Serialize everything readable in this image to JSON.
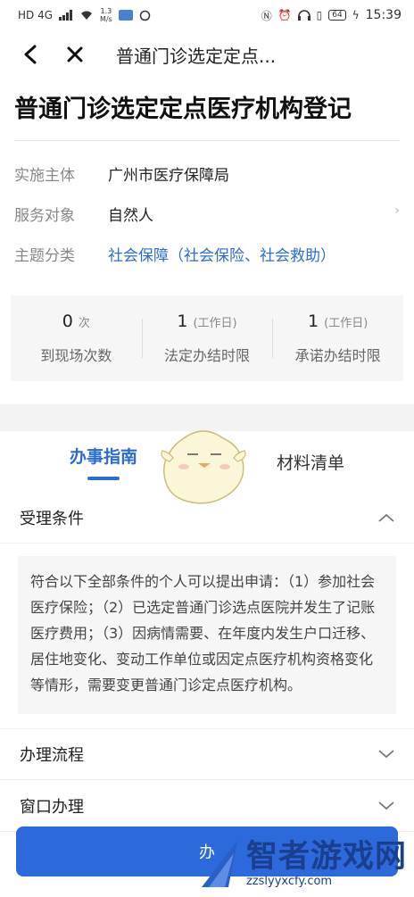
{
  "status_bar": {
    "network": "HD 4G",
    "speed_value": "1.3",
    "speed_unit": "M/s",
    "battery": "64",
    "time": "15:39"
  },
  "nav": {
    "title": "普通门诊选定定点..."
  },
  "page": {
    "title": "普通门诊选定定点医疗机构登记"
  },
  "info": {
    "rows": [
      {
        "label": "实施主体",
        "value": "广州市医疗保障局"
      },
      {
        "label": "服务对象",
        "value": "自然人"
      },
      {
        "label": "主题分类",
        "value": "社会保障（社会保险、社会救助）"
      }
    ]
  },
  "stats": [
    {
      "num": "0",
      "unit": "次",
      "label": "到现场次数"
    },
    {
      "num": "1",
      "unit": "(工作日)",
      "label": "法定办结时限"
    },
    {
      "num": "1",
      "unit": "(工作日)",
      "label": "承诺办结时限"
    }
  ],
  "tabs": [
    {
      "label": "办事指南",
      "active": true
    },
    {
      "label": "材料清单",
      "active": false
    }
  ],
  "sections": {
    "conditions": {
      "title": "受理条件",
      "text": "符合以下全部条件的个人可以提出申请：（1）参加社会医疗保险；（2）已选定普通门诊选点医院并发生了记账医疗费用；（3）因病情需要、在年度内发生户口迁移、居住地变化、变动工作单位或因定点医疗机构资格变化等情形，需要变更普通门诊定点医疗机构。"
    },
    "process": {
      "title": "办理流程"
    },
    "window": {
      "title": "窗口办理"
    }
  },
  "cta": {
    "label": "办"
  },
  "watermark": {
    "main": "智者游戏网",
    "sub": "zzslyyxcfy.com"
  },
  "colors": {
    "accent": "#2a6bd6",
    "button": "#2c69da"
  }
}
